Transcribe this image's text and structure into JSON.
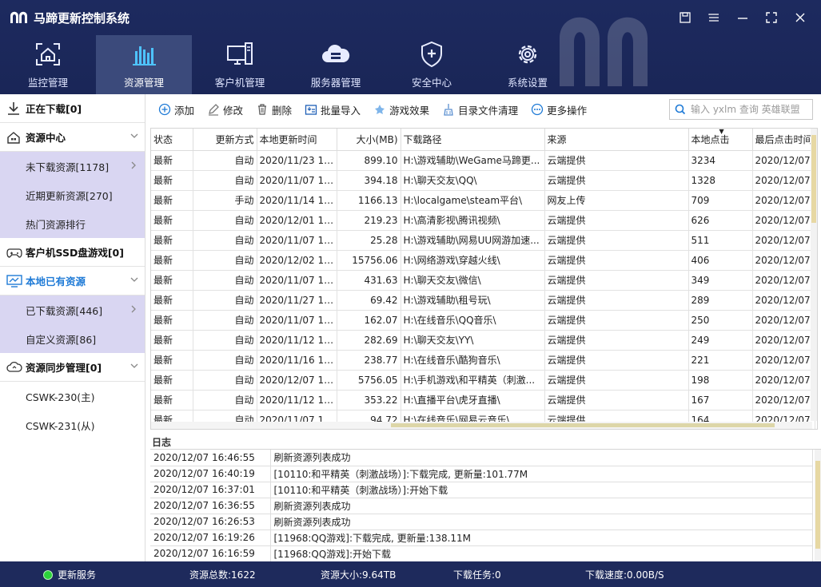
{
  "app": {
    "title": "马蹄更新控制系统"
  },
  "nav": [
    {
      "label": "监控管理",
      "icon": "home-monitor-icon"
    },
    {
      "label": "资源管理",
      "icon": "bar-chart-icon",
      "active": true
    },
    {
      "label": "客户机管理",
      "icon": "monitor-icon"
    },
    {
      "label": "服务器管理",
      "icon": "cloud-server-icon"
    },
    {
      "label": "安全中心",
      "icon": "shield-plus-icon"
    },
    {
      "label": "系统设置",
      "icon": "gear-icon"
    }
  ],
  "sidebar": {
    "downloading": "正在下载[0]",
    "resource_center": "资源中心",
    "not_downloaded": "未下载资源[1178]",
    "recent_updated": "近期更新资源[270]",
    "hot_rank": "热门资源排行",
    "ssd_games": "客户机SSD盘游戏[0]",
    "local_resources": "本地已有资源",
    "downloaded": "已下载资源[446]",
    "custom": "自定义资源[86]",
    "sync_mgmt": "资源同步管理[0]",
    "server_main": "CSWK-230(主)",
    "server_slave": "CSWK-231(从)"
  },
  "toolbar": {
    "add": "添加",
    "edit": "修改",
    "delete": "删除",
    "batch_import": "批量导入",
    "game_effect": "游戏效果",
    "dir_cleanup": "目录文件清理",
    "more": "更多操作",
    "search_placeholder": "输入 yxlm 查询 英雄联盟"
  },
  "table": {
    "headers": [
      "状态",
      "更新方式",
      "本地更新时间",
      "大小(MB)",
      "下载路径",
      "来源",
      "本地点击",
      "最后点击时间"
    ],
    "rows": [
      [
        "最新",
        "自动",
        "2020/11/23 18...",
        "899.10",
        "H:\\游戏辅助\\WeGame马蹄更...",
        "云端提供",
        "3234",
        "2020/12/07"
      ],
      [
        "最新",
        "自动",
        "2020/11/07 10...",
        "394.18",
        "H:\\聊天交友\\QQ\\",
        "云端提供",
        "1328",
        "2020/12/07"
      ],
      [
        "最新",
        "手动",
        "2020/11/14 17...",
        "1166.13",
        "H:\\localgame\\steam平台\\",
        "网友上传",
        "709",
        "2020/12/07"
      ],
      [
        "最新",
        "自动",
        "2020/12/01 11...",
        "219.23",
        "H:\\高清影视\\腾讯视频\\",
        "云端提供",
        "626",
        "2020/12/07"
      ],
      [
        "最新",
        "自动",
        "2020/11/07 10...",
        "25.28",
        "H:\\游戏辅助\\网易UU网游加速...",
        "云端提供",
        "511",
        "2020/12/07"
      ],
      [
        "最新",
        "自动",
        "2020/12/02 10...",
        "15756.06",
        "H:\\网络游戏\\穿越火线\\",
        "云端提供",
        "406",
        "2020/12/07"
      ],
      [
        "最新",
        "自动",
        "2020/11/07 10...",
        "431.63",
        "H:\\聊天交友\\微信\\",
        "云端提供",
        "349",
        "2020/12/07"
      ],
      [
        "最新",
        "自动",
        "2020/11/27 11...",
        "69.42",
        "H:\\游戏辅助\\租号玩\\",
        "云端提供",
        "289",
        "2020/12/07"
      ],
      [
        "最新",
        "自动",
        "2020/11/07 11...",
        "162.07",
        "H:\\在线音乐\\QQ音乐\\",
        "云端提供",
        "250",
        "2020/12/07"
      ],
      [
        "最新",
        "自动",
        "2020/11/12 13...",
        "282.69",
        "H:\\聊天交友\\YY\\",
        "云端提供",
        "249",
        "2020/12/07"
      ],
      [
        "最新",
        "自动",
        "2020/11/16 11...",
        "238.77",
        "H:\\在线音乐\\酷狗音乐\\",
        "云端提供",
        "221",
        "2020/12/07"
      ],
      [
        "最新",
        "自动",
        "2020/12/07 16...",
        "5756.05",
        "H:\\手机游戏\\和平精英（刺激...",
        "云端提供",
        "198",
        "2020/12/07"
      ],
      [
        "最新",
        "自动",
        "2020/11/12 15...",
        "353.22",
        "H:\\直播平台\\虎牙直播\\",
        "云端提供",
        "167",
        "2020/12/07"
      ],
      [
        "最新",
        "自动",
        "2020/11/07 10...",
        "94.72",
        "H:\\在线音乐\\网易云音乐\\",
        "云端提供",
        "164",
        "2020/12/07"
      ]
    ]
  },
  "log": {
    "title": "日志",
    "rows": [
      [
        "2020/12/07 16:46:55",
        "刷新资源列表成功"
      ],
      [
        "2020/12/07 16:40:19",
        "[10110:和平精英（刺激战场）]:下载完成, 更新量:101.77M"
      ],
      [
        "2020/12/07 16:37:01",
        "[10110:和平精英（刺激战场）]:开始下载"
      ],
      [
        "2020/12/07 16:36:55",
        "刷新资源列表成功"
      ],
      [
        "2020/12/07 16:26:53",
        "刷新资源列表成功"
      ],
      [
        "2020/12/07 16:19:26",
        "[11968:QQ游戏]:下载完成, 更新量:138.11M"
      ],
      [
        "2020/12/07 16:16:59",
        "[11968:QQ游戏]:开始下载"
      ]
    ]
  },
  "status": {
    "service": "更新服务",
    "total": "资源总数:1622",
    "size": "资源大小:9.64TB",
    "tasks": "下载任务:0",
    "speed": "下载速度:0.00B/S"
  },
  "colors": {
    "header_bg": "#1d2a5f",
    "active_tab": "#3b4a7b",
    "sidebar_highlight": "#d9d6f2",
    "accent_blue": "#1e7ad6",
    "status_green": "#2bd13a"
  }
}
